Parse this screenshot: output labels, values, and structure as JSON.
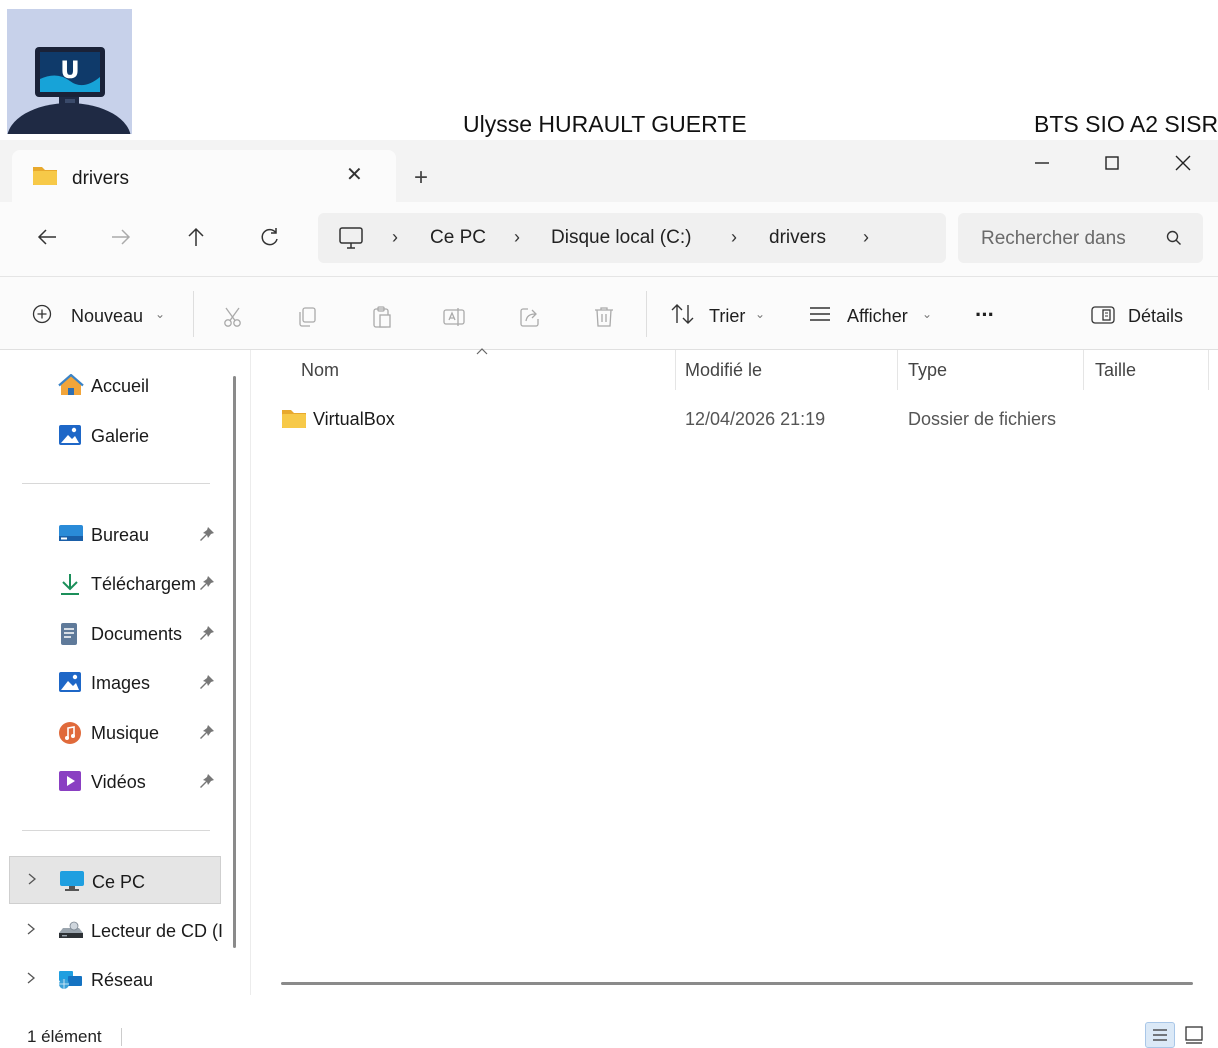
{
  "header": {
    "author": "Ulysse HURAULT GUERTE",
    "course": "BTS SIO A2 SISR"
  },
  "window": {
    "tab_title": "drivers",
    "new_tab_label": "+",
    "minimize_label": "—",
    "maximize_label": "☐",
    "close_label": "✕"
  },
  "address": {
    "crumbs": [
      "Ce PC",
      "Disque local (C:)",
      "drivers"
    ],
    "search_placeholder": "Rechercher dans"
  },
  "toolbar": {
    "new_label": "Nouveau",
    "sort_label": "Trier",
    "view_label": "Afficher",
    "more_label": "···",
    "details_label": "Détails"
  },
  "sidebar": {
    "quick": [
      "Accueil",
      "Galerie"
    ],
    "pinned": [
      "Bureau",
      "Téléchargem",
      "Documents",
      "Images",
      "Musique",
      "Vidéos"
    ],
    "drives": [
      "Ce PC",
      "Lecteur de CD (I",
      "Réseau"
    ]
  },
  "filelist": {
    "columns": [
      "Nom",
      "Modifié le",
      "Type",
      "Taille"
    ],
    "rows": [
      {
        "name": "VirtualBox",
        "modified": "12/04/2026 21:19",
        "type": "Dossier de fichiers",
        "size": ""
      }
    ]
  },
  "status": {
    "count": "1 élément"
  },
  "colors": {
    "folder": "#f5c443",
    "accent": "#0067c0",
    "selected": "#e5e5e5"
  }
}
